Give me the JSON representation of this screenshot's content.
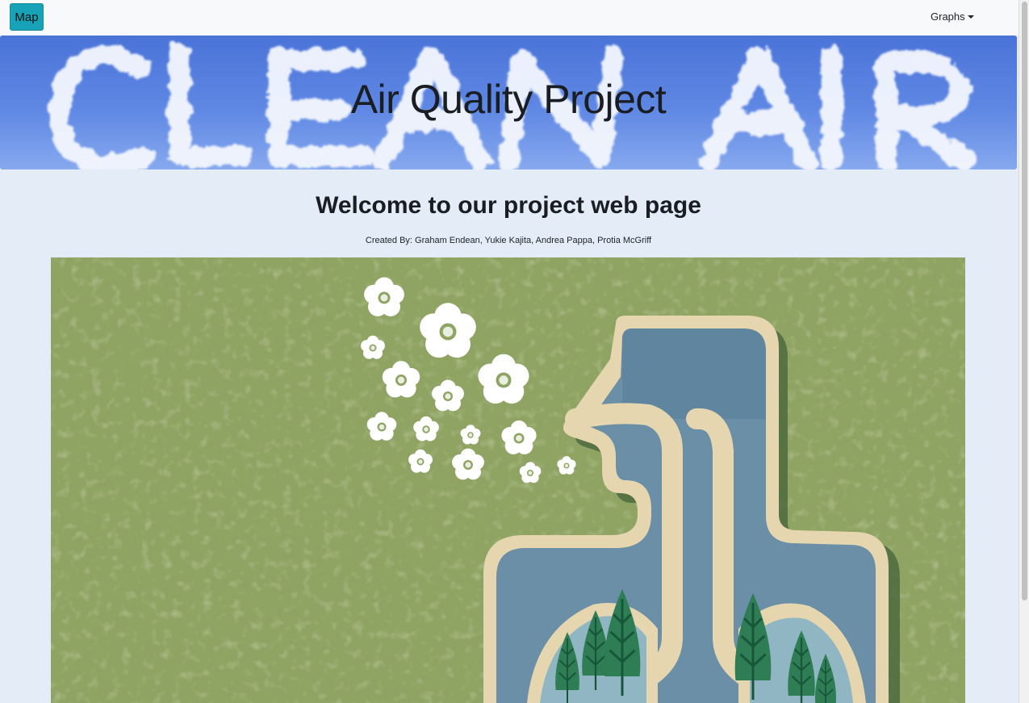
{
  "navbar": {
    "map_label": "Map",
    "graphs_label": "Graphs"
  },
  "hero": {
    "title": "Air Quality Project",
    "cloud_text": "CLEAN AIR"
  },
  "main": {
    "welcome": "Welcome to our project web page",
    "credits": "Created By: Graham Endean, Yukie Kajita, Andrea Pappa, Protia McGriff"
  },
  "colors": {
    "map_button": "#17a2b8",
    "page_background": "#e3ecf7",
    "sky": "#5f88e4",
    "poster_green": "#8fa362",
    "poster_blue": "#6a8fa6",
    "poster_tan": "#e6d6b0",
    "tree_green": "#2f7d55"
  }
}
